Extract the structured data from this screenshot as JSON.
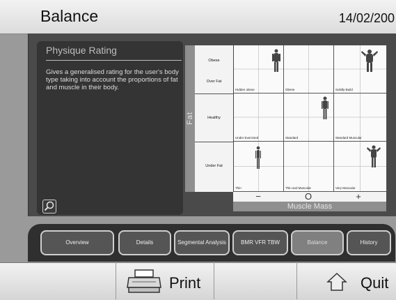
{
  "header": {
    "title": "Balance",
    "date": "14/02/200"
  },
  "panel": {
    "title": "Physique Rating",
    "description": "Gives a generalised rating for the user's body type taking into account the proportions of fat and muscle in their body."
  },
  "chart": {
    "y_axis_label": "Fat",
    "x_axis_label": "Muscle Mass",
    "row_labels": [
      "Obese",
      "Over Fat",
      "Healthy",
      "Under Fat"
    ],
    "x_symbols": [
      "−",
      "O",
      "+"
    ],
    "cells": [
      [
        "Hidden obese",
        "Obese",
        "Solidly-Build"
      ],
      [
        "Under Exercised",
        "Standard",
        "Standard Muscular"
      ],
      [
        "Thin",
        "Thin and Muscular",
        "Very Muscular"
      ]
    ]
  },
  "tabs": [
    {
      "label": "Overview"
    },
    {
      "label": "Details"
    },
    {
      "label": "Segmental Analysis"
    },
    {
      "label": "BMR VFR TBW"
    },
    {
      "label": "Balance"
    },
    {
      "label": "History"
    }
  ],
  "footer": {
    "print_label": "Print",
    "quit_label": "Quit"
  },
  "icons": [
    "magnifier-icon",
    "printer-icon",
    "home-icon",
    "body-figure-icon"
  ]
}
